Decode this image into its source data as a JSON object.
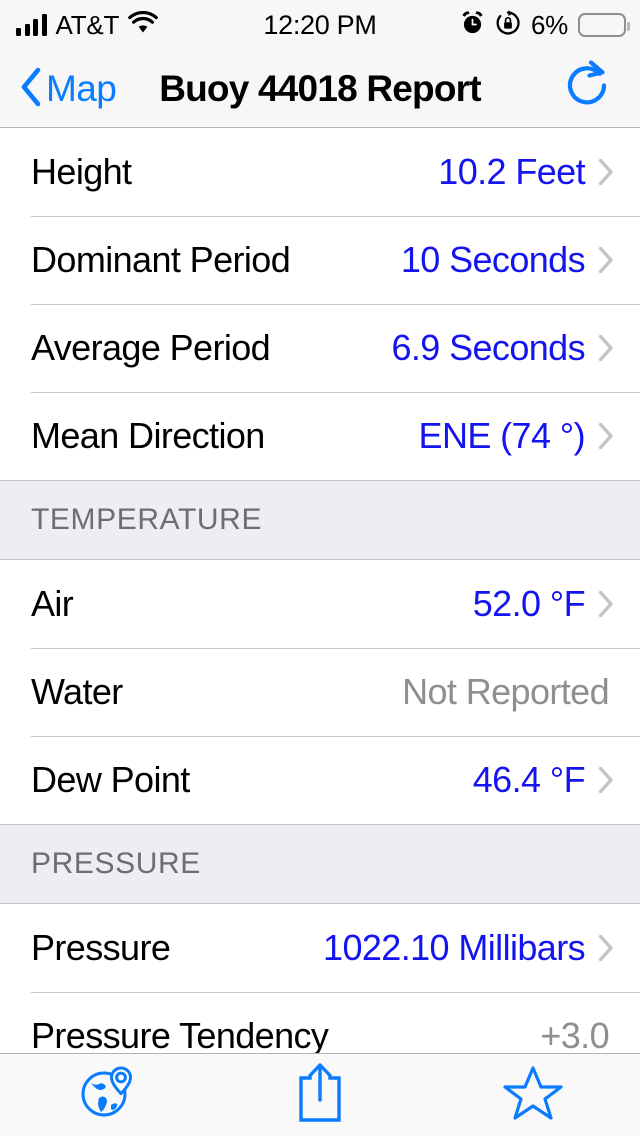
{
  "statusbar": {
    "carrier": "AT&T",
    "time": "12:20 PM",
    "battery_percent": "6%",
    "battery_level": 6,
    "icons": [
      "signal-bars-icon",
      "wifi-icon",
      "alarm-clock-icon",
      "rotation-lock-icon",
      "battery-icon"
    ]
  },
  "navbar": {
    "back_label": "Map",
    "title": "Buoy 44018 Report",
    "refresh_icon": "refresh-icon",
    "accent_color": "#0a7cff"
  },
  "colors": {
    "value_blue": "#1414f0",
    "value_gray": "#8e8e93",
    "section_header_text": "#6d6d72",
    "section_header_bg": "#eeeef2",
    "chevron": "#c4c4c6",
    "separator": "#c8c7cc"
  },
  "sections": [
    {
      "header": null,
      "rows": [
        {
          "label": "Height",
          "value": "10.2 Feet",
          "style": "blue",
          "chevron": true
        },
        {
          "label": "Dominant Period",
          "value": "10 Seconds",
          "style": "blue",
          "chevron": true
        },
        {
          "label": "Average Period",
          "value": "6.9 Seconds",
          "style": "blue",
          "chevron": true
        },
        {
          "label": "Mean Direction",
          "value": "ENE (74 °)",
          "style": "blue",
          "chevron": true
        }
      ]
    },
    {
      "header": "TEMPERATURE",
      "rows": [
        {
          "label": "Air",
          "value": "52.0 °F",
          "style": "blue",
          "chevron": true
        },
        {
          "label": "Water",
          "value": "Not Reported",
          "style": "gray",
          "chevron": false
        },
        {
          "label": "Dew Point",
          "value": "46.4 °F",
          "style": "blue",
          "chevron": true
        }
      ]
    },
    {
      "header": "PRESSURE",
      "rows": [
        {
          "label": "Pressure",
          "value": "1022.10 Millibars",
          "style": "blue",
          "chevron": true
        },
        {
          "label": "Pressure Tendency",
          "value": "+3.0",
          "style": "gray",
          "chevron": false
        }
      ]
    }
  ],
  "toolbar": {
    "buttons": [
      {
        "name": "globe-pin-icon",
        "label": "Map"
      },
      {
        "name": "share-icon",
        "label": "Share"
      },
      {
        "name": "star-icon",
        "label": "Favorite"
      }
    ],
    "tint": "#0a7cff"
  }
}
